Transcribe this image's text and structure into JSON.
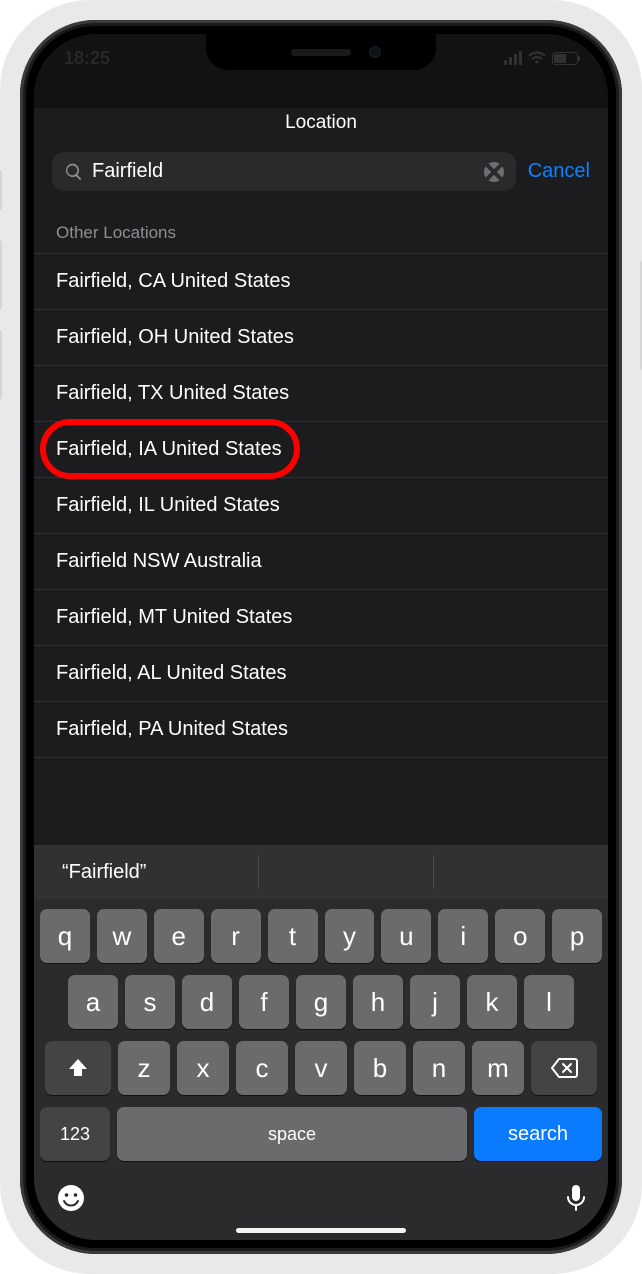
{
  "status": {
    "time": "18:25"
  },
  "header": {
    "title": "Location"
  },
  "search": {
    "value": "Fairfield",
    "cancel_label": "Cancel",
    "clear_icon": "clear-icon"
  },
  "section_header": "Other Locations",
  "results": [
    "Fairfield, CA United States",
    "Fairfield, OH United States",
    "Fairfield, TX United States",
    "Fairfield, IA United States",
    "Fairfield, IL United States",
    "Fairfield NSW Australia",
    "Fairfield, MT United States",
    "Fairfield, AL United States",
    "Fairfield, PA United States"
  ],
  "highlighted_result_index": 3,
  "keyboard": {
    "suggestion": "“Fairfield”",
    "rows": [
      [
        "q",
        "w",
        "e",
        "r",
        "t",
        "y",
        "u",
        "i",
        "o",
        "p"
      ],
      [
        "a",
        "s",
        "d",
        "f",
        "g",
        "h",
        "j",
        "k",
        "l"
      ],
      [
        "z",
        "x",
        "c",
        "v",
        "b",
        "n",
        "m"
      ]
    ],
    "num_label": "123",
    "space_label": "space",
    "search_label": "search"
  }
}
